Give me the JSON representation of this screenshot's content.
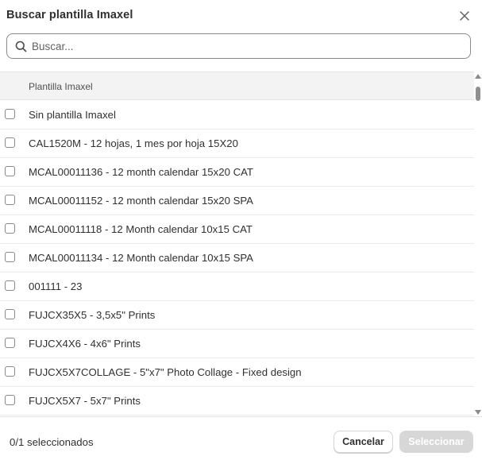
{
  "dialog": {
    "title": "Buscar plantilla Imaxel",
    "close_icon": "close-icon"
  },
  "search": {
    "placeholder": "Buscar...",
    "value": "",
    "icon": "search-icon"
  },
  "table": {
    "column_header": "Plantilla Imaxel",
    "rows": [
      {
        "label": "Sin plantilla Imaxel",
        "checked": false
      },
      {
        "label": "CAL1520M - 12 hojas, 1 mes por hoja 15X20",
        "checked": false
      },
      {
        "label": "MCAL00011136 - 12 month calendar 15x20 CAT",
        "checked": false
      },
      {
        "label": "MCAL00011152 - 12 month calendar 15x20 SPA",
        "checked": false
      },
      {
        "label": "MCAL00011118 - 12 Month calendar 10x15 CAT",
        "checked": false
      },
      {
        "label": "MCAL00011134 - 12 Month calendar 10x15 SPA",
        "checked": false
      },
      {
        "label": "001111 - 23",
        "checked": false
      },
      {
        "label": "FUJCX35X5 - 3,5x5\" Prints",
        "checked": false
      },
      {
        "label": "FUJCX4X6 - 4x6\" Prints",
        "checked": false
      },
      {
        "label": "FUJCX5X7COLLAGE - 5\"x7\" Photo Collage - Fixed design",
        "checked": false
      },
      {
        "label": "FUJCX5X7 - 5x7\" Prints",
        "checked": false
      }
    ]
  },
  "footer": {
    "selection_count": "0/1 seleccionados",
    "cancel_label": "Cancelar",
    "select_label": "Seleccionar"
  },
  "colors": {
    "text": "#303030",
    "border": "#8a8a8a",
    "header_bg": "#f3f3f3",
    "disabled_button": "#d7d7d7"
  }
}
